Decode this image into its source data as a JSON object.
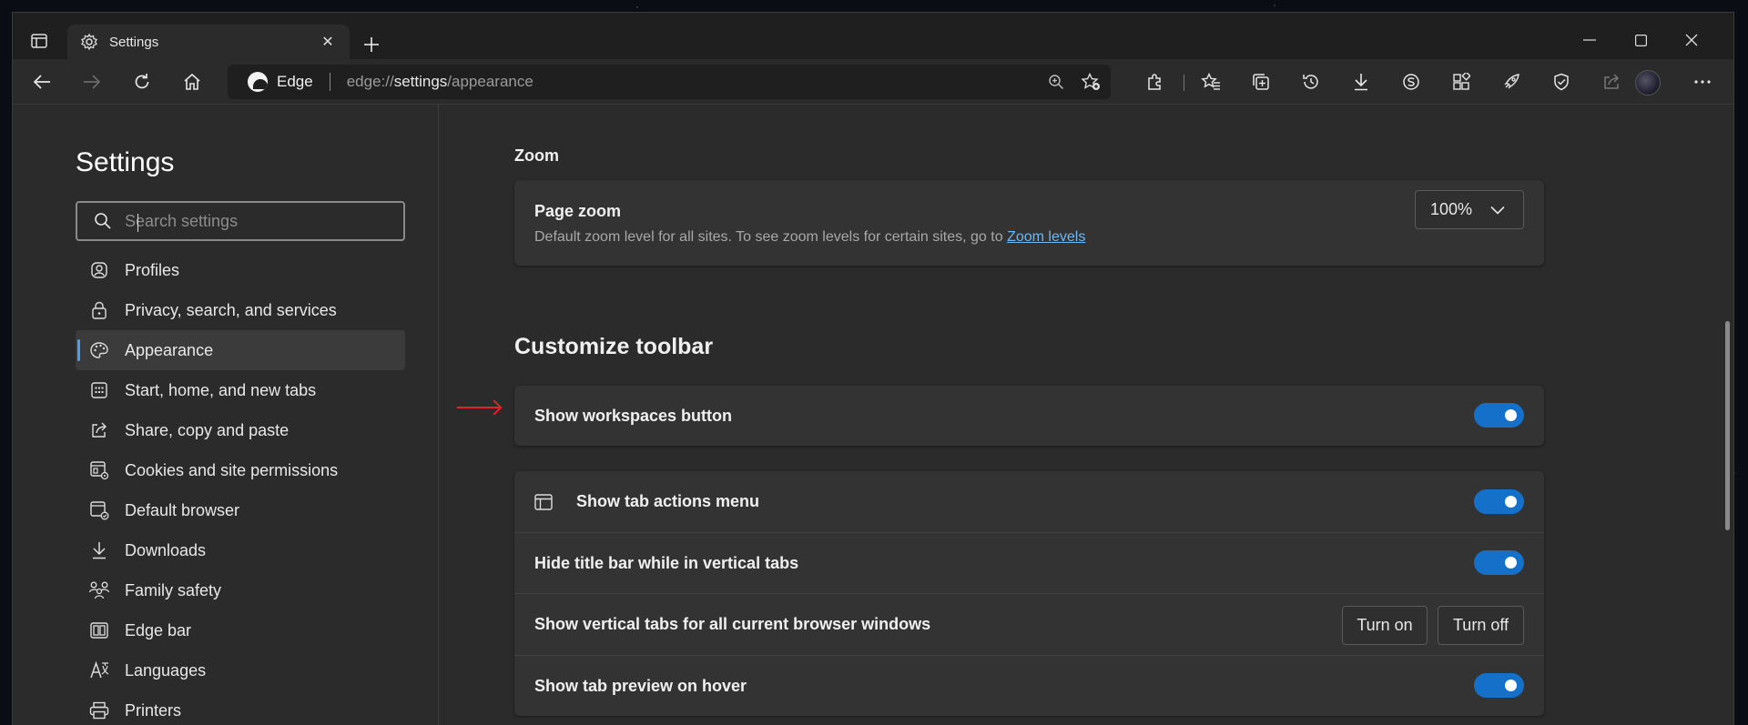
{
  "tab": {
    "title": "Settings",
    "close_label": "✕"
  },
  "toolbar": {
    "brand": "Edge",
    "url_prefix": "edge://",
    "url_path": "settings",
    "url_suffix": "/appearance"
  },
  "sidebar": {
    "title": "Settings",
    "search_placeholder": "Search settings",
    "items": [
      {
        "label": "Profiles",
        "icon": "profile-icon"
      },
      {
        "label": "Privacy, search, and services",
        "icon": "lock-icon"
      },
      {
        "label": "Appearance",
        "icon": "palette-icon",
        "active": true
      },
      {
        "label": "Start, home, and new tabs",
        "icon": "grid-icon"
      },
      {
        "label": "Share, copy and paste",
        "icon": "share-icon"
      },
      {
        "label": "Cookies and site permissions",
        "icon": "cookie-icon"
      },
      {
        "label": "Default browser",
        "icon": "browser-icon"
      },
      {
        "label": "Downloads",
        "icon": "download-icon"
      },
      {
        "label": "Family safety",
        "icon": "family-icon"
      },
      {
        "label": "Edge bar",
        "icon": "sidebar-icon"
      },
      {
        "label": "Languages",
        "icon": "language-icon"
      },
      {
        "label": "Printers",
        "icon": "printer-icon"
      }
    ]
  },
  "main": {
    "zoom_heading": "Zoom",
    "page_zoom": {
      "title": "Page zoom",
      "description": "Default zoom level for all sites. To see zoom levels for certain sites, go to",
      "link": "Zoom levels",
      "value": "100%"
    },
    "toolbar_heading": "Customize toolbar",
    "workspaces": {
      "label": "Show workspaces button",
      "on": true
    },
    "rows": [
      {
        "label": "Show tab actions menu",
        "on": true
      },
      {
        "label": "Hide title bar while in vertical tabs",
        "on": true
      },
      {
        "label": "Show vertical tabs for all current browser windows",
        "button_on": "Turn on",
        "button_off": "Turn off"
      },
      {
        "label": "Show tab preview on hover",
        "on": true
      }
    ]
  },
  "colors": {
    "accent": "#1470c8",
    "link": "#6cb8f6",
    "annotation_arrow": "#e0252b",
    "nav_indicator": "#4aa0f0"
  }
}
